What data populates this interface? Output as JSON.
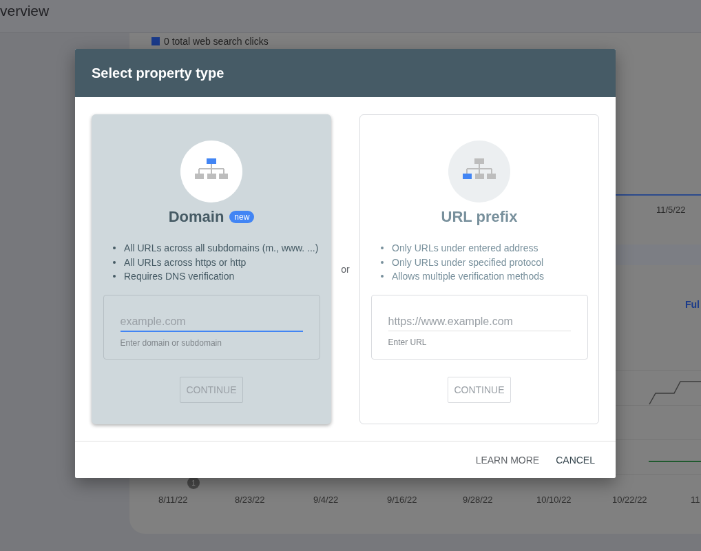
{
  "background": {
    "page_title": "verview",
    "legend": "0 total web search clicks",
    "date_label": "11/5/22",
    "link": "Ful",
    "marker": "1",
    "x_axis": [
      "8/11/22",
      "8/23/22",
      "9/4/22",
      "9/16/22",
      "9/28/22",
      "10/10/22",
      "10/22/22",
      "11"
    ]
  },
  "dialog": {
    "title": "Select property type",
    "separator": "or",
    "options": [
      {
        "title": "Domain",
        "badge": "new",
        "selected": true,
        "kind": "domain",
        "bullets": [
          "All URLs across all subdomains (m., www. ...)",
          "All URLs across https or http",
          "Requires DNS verification"
        ],
        "placeholder": "example.com",
        "helper": "Enter domain or subdomain",
        "button": {
          "label": "CONTINUE",
          "disabled": true
        }
      },
      {
        "title": "URL prefix",
        "selected": false,
        "kind": "prefix",
        "bullets": [
          "Only URLs under entered address",
          "Only URLs under specified protocol",
          "Allows multiple verification methods"
        ],
        "placeholder": "https://www.example.com",
        "helper": "Enter URL",
        "button": {
          "label": "CONTINUE",
          "disabled": true
        }
      }
    ],
    "buttons": [
      {
        "label": "LEARN MORE",
        "kind": "secondary"
      },
      {
        "label": "CANCEL",
        "kind": "primary"
      }
    ]
  }
}
